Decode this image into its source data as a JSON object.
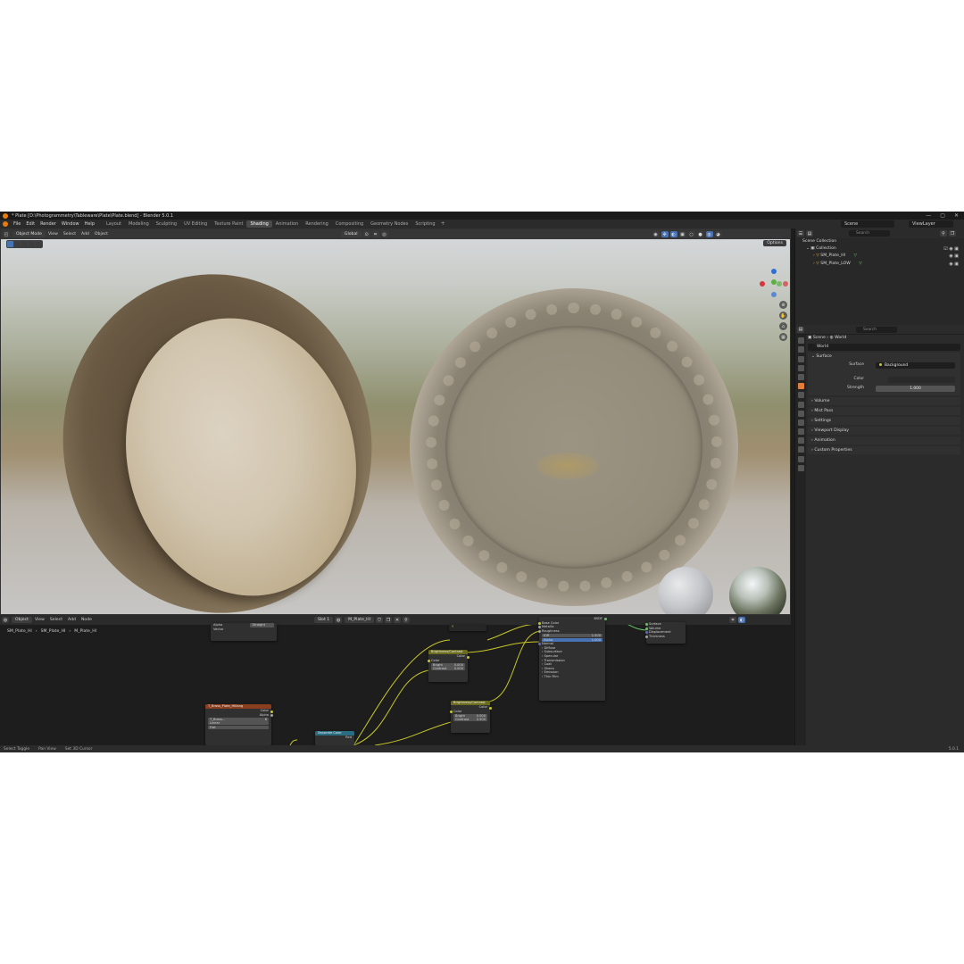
{
  "window": {
    "title": "* Plate [D:\\Photogrammetry\\Tableware\\Plate\\Plate.blend] - Blender 5.0.1",
    "controls": [
      "—",
      "▢",
      "✕"
    ]
  },
  "menubar": {
    "items": [
      "File",
      "Edit",
      "Render",
      "Window",
      "Help"
    ],
    "workspaces": [
      "Layout",
      "Modeling",
      "Sculpting",
      "UV Editing",
      "Texture Paint",
      "Shading",
      "Animation",
      "Rendering",
      "Compositing",
      "Geometry Nodes",
      "Scripting"
    ],
    "active_workspace": "Shading",
    "scene": "Scene",
    "view_layer": "ViewLayer"
  },
  "viewport": {
    "mode": "Object Mode",
    "menus": [
      "View",
      "Select",
      "Add",
      "Object"
    ],
    "transform_orientation": "Global",
    "options": "Options"
  },
  "node_editor": {
    "editor_mode": "Object",
    "menus": [
      "View",
      "Select",
      "Add",
      "Node"
    ],
    "slot": "Slot 1",
    "material": "M_Plate_HI",
    "breadcrumb": [
      "SM_Plate_HI",
      "SM_Plate_HI",
      "M_Plate_HI"
    ],
    "nodes": {
      "top_partial": {
        "alpha_label": "Alpha",
        "alpha_value": "Straight",
        "vector": "Vector"
      },
      "image_texture": {
        "title": "T_Brass_Plate_HIKang",
        "out_color": "Color",
        "out_alpha": "Alpha",
        "image": "T_Brass...",
        "users": "8",
        "interp": "Linear",
        "proj": "Flat"
      },
      "separate_color": {
        "title": "Separate Color",
        "out": "Red"
      },
      "bc1": {
        "title": "Brightness/Contrast",
        "out": "Color",
        "in": "Color",
        "bright_label": "Bright",
        "bright": "0.000",
        "contrast_label": "Contrast",
        "contrast": "0.000"
      },
      "bc2": {
        "title": "Brightness/Contrast",
        "out": "Color",
        "in": "Color",
        "bright_label": "Bright",
        "bright": "0.000",
        "contrast_label": "Contrast",
        "contrast": "0.500"
      },
      "reroute_label": "Y",
      "principled": {
        "title": "BSDF",
        "rows": [
          "Base Color",
          "Metallic",
          "Roughness"
        ],
        "ior_label": "IOR",
        "ior": "1.500",
        "alpha_label": "Alpha",
        "alpha": "1.000",
        "rows2": [
          "Normal",
          "Diffuse",
          "Subsurface",
          "Specular",
          "Transmission",
          "Coat",
          "Sheen",
          "Emission",
          "Thin Film"
        ]
      },
      "output": {
        "rows": [
          "Surface",
          "Volume",
          "Displacement",
          "Thickness"
        ]
      }
    }
  },
  "statusbar": {
    "items": [
      "Select Toggle",
      "Pan View",
      "Set 3D Cursor"
    ],
    "version": "5.0.1"
  },
  "outliner": {
    "search_placeholder": "Search",
    "scene_collection": "Scene Collection",
    "collection": "Collection",
    "objects": [
      "SM_Plate_HI",
      "SM_Plate_LOW"
    ]
  },
  "properties": {
    "search_placeholder": "Search",
    "breadcrumb": [
      "Scene",
      "World"
    ],
    "world_name": "World",
    "surface_panel": "Surface",
    "surface_label": "Surface",
    "surface_value": "Background",
    "color_label": "Color",
    "strength_label": "Strength",
    "strength_value": "1.000",
    "panels": [
      "Volume",
      "Mist Pass",
      "Settings",
      "Viewport Display",
      "Animation",
      "Custom Properties"
    ]
  }
}
